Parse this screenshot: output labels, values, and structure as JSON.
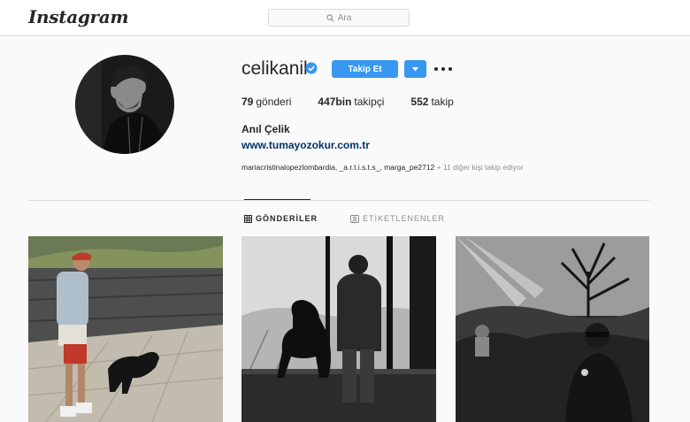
{
  "header": {
    "logo": "Instagram",
    "search_placeholder": "Ara"
  },
  "profile": {
    "username": "celikanil",
    "verified": true,
    "follow_label": "Takip Et",
    "posts_count": "79",
    "posts_label": "gönderi",
    "followers_count": "447bin",
    "followers_label": "takipçi",
    "following_count": "552",
    "following_label": "takip",
    "full_name": "Anıl Çelik",
    "website": "www.tumayozokur.com.tr",
    "followed_by_names": "mariacristinalopezlombardia, _a.r.t.i.s.t.s_, marga_pe2712",
    "followed_by_more": " + 11 diğer kişi takip ediyor"
  },
  "tabs": [
    {
      "label": "GÖNDERİLER",
      "active": true
    },
    {
      "label": "ETİKETLENENLER",
      "active": false
    }
  ],
  "colors": {
    "accent": "#3897f0",
    "link": "#003569",
    "border": "#dbdbdb"
  },
  "icons": [
    "search-icon",
    "verified-badge-icon",
    "chevron-down-icon",
    "more-options-icon",
    "grid-icon",
    "tagged-icon"
  ]
}
